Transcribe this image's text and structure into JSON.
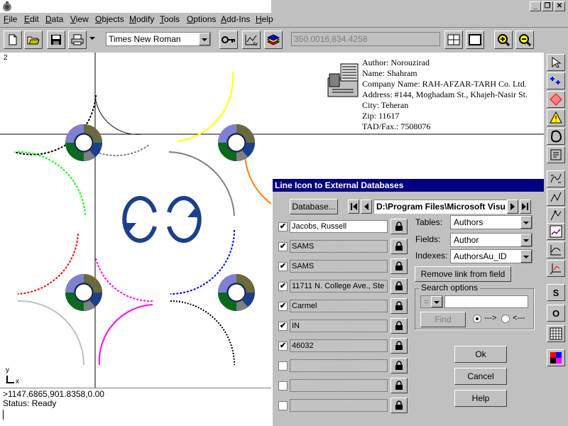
{
  "window": {
    "min_label": "_",
    "restore_label": "❐",
    "close_label": "✕"
  },
  "menu": [
    "File",
    "Edit",
    "Data",
    "View",
    "Objects",
    "Modify",
    "Tools",
    "Options",
    "Add-Ins",
    "Help"
  ],
  "toolbar": {
    "font_name": "Times New Roman",
    "coords": "350.0016,834.4258"
  },
  "canvas": {
    "corner_label": "2",
    "axis_y": "y",
    "axis_x": "x"
  },
  "info": {
    "lines": [
      "Author: Norouzirad",
      "Name: Shahram",
      "Company Name: RAH-AFZAR-TARH Co. Ltd.",
      "Address: #144, Moghadam St., Khajeh-Nasir St.",
      "City: Teheran",
      "Zip: 11617",
      "TAD/Fax.: 7508076"
    ]
  },
  "command": {
    "line1": ">1147.6865,901.8358,0.00",
    "line2": "Status: Ready"
  },
  "dialog": {
    "title": "Line Icon to External Databases",
    "database_button": "Database...",
    "path": "D:\\Program Files\\Microsoft Visu",
    "rows": [
      {
        "checked": true,
        "value": "Jacobs, Russell"
      },
      {
        "checked": true,
        "value": "SAMS"
      },
      {
        "checked": true,
        "value": "SAMS"
      },
      {
        "checked": true,
        "value": "11711 N. College Ave., Ste"
      },
      {
        "checked": true,
        "value": "Carmel"
      },
      {
        "checked": true,
        "value": "IN"
      },
      {
        "checked": true,
        "value": "46032"
      },
      {
        "checked": false,
        "value": ""
      },
      {
        "checked": false,
        "value": ""
      },
      {
        "checked": false,
        "value": ""
      }
    ],
    "tables_label": "Tables:",
    "tables_value": "Authors",
    "fields_label": "Fields:",
    "fields_value": "Author",
    "indexes_label": "Indexes:",
    "indexes_value": "AuthorsAu_ID",
    "remove_button": "Remove link from field",
    "search_group": "Search options",
    "search_op": "=",
    "search_value": "",
    "find_button": "Find",
    "dir_forward": "--->",
    "dir_back": "<---",
    "ok_button": "Ok",
    "cancel_button": "Cancel",
    "help_button": "Help"
  },
  "palette": {
    "s_label": "S",
    "o_label": "O"
  },
  "colors": {
    "title_bar": "#000080",
    "face": "#c0c0c0"
  }
}
